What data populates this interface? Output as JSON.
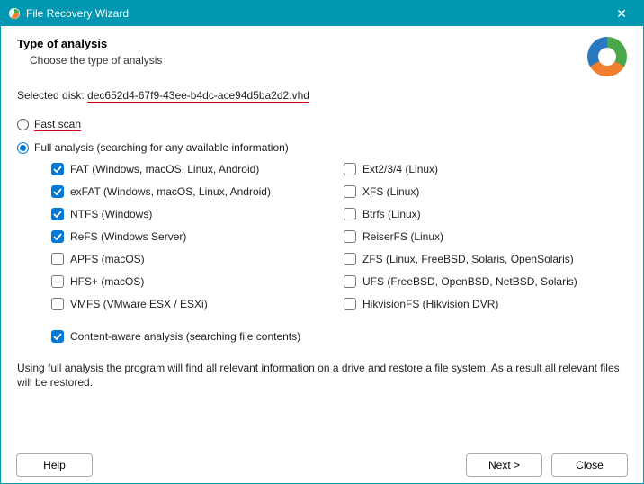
{
  "titlebar": {
    "title": "File Recovery Wizard",
    "close": "✕"
  },
  "header": {
    "title": "Type of analysis",
    "subtitle": "Choose the type of analysis"
  },
  "selected_disk": {
    "label": "Selected disk: ",
    "value": "dec652d4-67f9-43ee-b4dc-ace94d5ba2d2.vhd"
  },
  "fast_scan": {
    "label": "Fast scan",
    "checked": false
  },
  "full_analysis": {
    "label": "Full analysis (searching for any available information)",
    "checked": true
  },
  "fs_left": [
    {
      "label": "FAT (Windows, macOS, Linux, Android)",
      "checked": true
    },
    {
      "label": "exFAT (Windows, macOS, Linux, Android)",
      "checked": true
    },
    {
      "label": "NTFS (Windows)",
      "checked": true
    },
    {
      "label": "ReFS (Windows Server)",
      "checked": true
    },
    {
      "label": "APFS (macOS)",
      "checked": false
    },
    {
      "label": "HFS+ (macOS)",
      "checked": false
    },
    {
      "label": "VMFS (VMware ESX / ESXi)",
      "checked": false
    }
  ],
  "fs_right": [
    {
      "label": "Ext2/3/4 (Linux)",
      "checked": false
    },
    {
      "label": "XFS (Linux)",
      "checked": false
    },
    {
      "label": "Btrfs (Linux)",
      "checked": false
    },
    {
      "label": "ReiserFS (Linux)",
      "checked": false
    },
    {
      "label": "ZFS (Linux, FreeBSD, Solaris, OpenSolaris)",
      "checked": false
    },
    {
      "label": "UFS (FreeBSD, OpenBSD, NetBSD, Solaris)",
      "checked": false
    },
    {
      "label": "HikvisionFS (Hikvision DVR)",
      "checked": false
    }
  ],
  "content_aware": {
    "label": "Content-aware analysis (searching file contents)",
    "checked": true
  },
  "info": "Using full analysis the program will find all relevant information on a drive and restore a file system. As a result all relevant files will be restored.",
  "buttons": {
    "help": "Help",
    "next": "Next >",
    "close": "Close"
  }
}
